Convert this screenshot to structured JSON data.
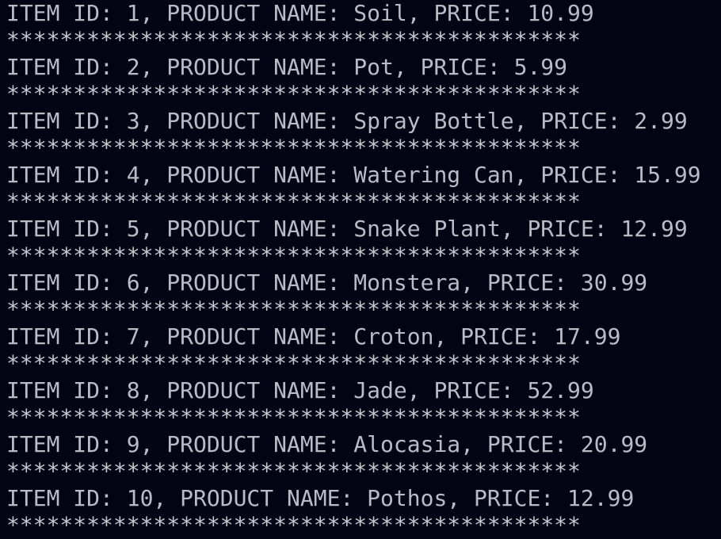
{
  "terminal": {
    "background": "#020313",
    "text_color": "#b8bcc6",
    "lines": [
      "ITEM ID: 1, PRODUCT NAME: Soil, PRICE: 10.99",
      "*******************************************",
      "ITEM ID: 2, PRODUCT NAME: Pot, PRICE: 5.99",
      "*******************************************",
      "ITEM ID: 3, PRODUCT NAME: Spray Bottle, PRICE: 2.99",
      "*******************************************",
      "ITEM ID: 4, PRODUCT NAME: Watering Can, PRICE: 15.99",
      "*******************************************",
      "ITEM ID: 5, PRODUCT NAME: Snake Plant, PRICE: 12.99",
      "*******************************************",
      "ITEM ID: 6, PRODUCT NAME: Monstera, PRICE: 30.99",
      "*******************************************",
      "ITEM ID: 7, PRODUCT NAME: Croton, PRICE: 17.99",
      "*******************************************",
      "ITEM ID: 8, PRODUCT NAME: Jade, PRICE: 52.99",
      "*******************************************",
      "ITEM ID: 9, PRODUCT NAME: Alocasia, PRICE: 20.99",
      "*******************************************",
      "ITEM ID: 10, PRODUCT NAME: Pothos, PRICE: 12.99",
      "*******************************************"
    ]
  }
}
